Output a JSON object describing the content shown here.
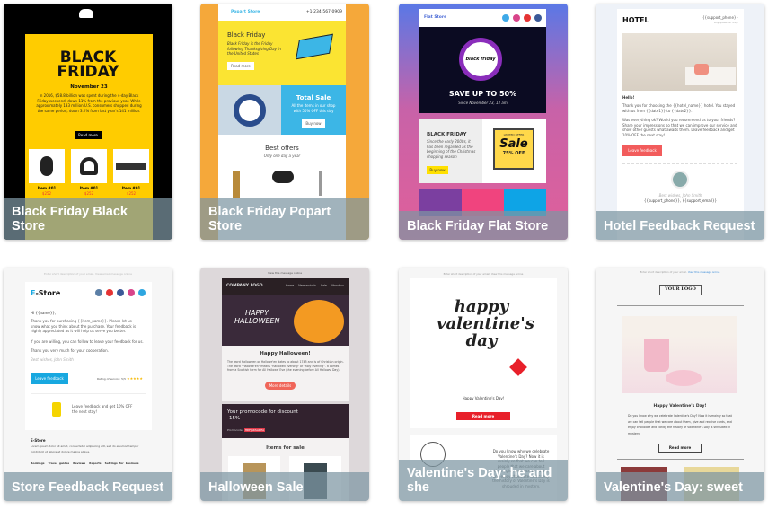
{
  "templates": [
    {
      "title": "Black Friday Black Store",
      "heading": "BLACK FRIDAY",
      "date": "November 23",
      "body": "In 2016, $58.8 billion was spent during the 4-day Black Friday weekend, down 11% from the previous year. While approximately 133 million U.S. consumers shopped during the same period, down 3.2% from last year's 141 million.",
      "button": "Read more",
      "items": [
        {
          "name": "Item #01",
          "price": "$252"
        },
        {
          "name": "Item #01",
          "price": "$252"
        },
        {
          "name": "Item #01",
          "price": "$252"
        }
      ]
    },
    {
      "title": "Black Friday Popart Store",
      "store": "Popart Store",
      "phone": "+1-234-567-0909",
      "heading": "Black Friday",
      "body": "Black Friday is the Friday following Thanksgiving Day in the United States",
      "button": "Read more",
      "sale_title": "Total Sale",
      "sale_text": "All the items in our shop with 50% OFF this day",
      "sale_button": "Buy now",
      "offers_title": "Best offers",
      "offers_sub": "Only one day a year"
    },
    {
      "title": "Black Friday Flat Store",
      "store": "Flat Store",
      "banner_text": "black friday",
      "headline": "SAVE UP TO 50%",
      "since": "Since November 23, 12 am",
      "panel_title": "BLACK FRIDAY",
      "panel_text": "Since the early 2000s, it has been regarded as the beginning of the Christmas shopping season",
      "panel_button": "Buy now",
      "badge_top": "LIMITED OFFER",
      "badge_main": "Sale",
      "badge_bottom": "75% OFF"
    },
    {
      "title": "Hotel Feedback Request",
      "logo": "HOTEL",
      "phone": "{{support_phone}}",
      "phone_note": "any question 24/7",
      "greeting": "Hello!",
      "p1": "Thank you for choosing the {{hotel_name}} hotel. You stayed with us from {{date1}} to {{date2}}.",
      "p2": "Was everything ok? Would you recommend us to your friends? Share your impressions so that we can improve our service and show other guests what awaits them. Leave feedback and get 10% OFF the next stay!",
      "button": "Leave feedback",
      "sign": "Best wishes, John Smith",
      "contacts": "{{support_phone}}, {{support_email}}"
    },
    {
      "title": "Store Feedback Request",
      "preheader": "Enter short description of your email. View email message online",
      "logo_e": "E",
      "logo_rest": "-Store",
      "greeting": "Hi {{name}},",
      "p1": "Thank you for purchasing {{item_name}}. Please let us know what you think about the purchase. Your feedback is highly appreciated as it will help us serve you better.",
      "p2": "If you are willing, you can follow to leave your feedback for us.",
      "p3": "Thank you very much for your cooperation.",
      "sign": "Best wishes, John Smith",
      "button": "Leave feedback",
      "rating": "Rating of service: 5/5",
      "stars": "★★★★★",
      "promo": "Leave feedback and get 10% OFF the next stay!",
      "footer_title": "E-Store",
      "footer_text": "Lorem ipsum dolor sit amet, consectetur adipiscing elit, sed do eiusmod tempor incididunt ut labore et dolore magna aliqua.",
      "footer_links": [
        "Bookings",
        "Travel guides",
        "Reviews",
        "Reports",
        "Settings for business"
      ]
    },
    {
      "title": "Halloween Sale",
      "preheader": "View this message online",
      "logo": "COMPANY LOGO",
      "nav": [
        "Home",
        "New arrivals",
        "Sale",
        "About us"
      ],
      "banner": "HAPPY HALLOWEEN",
      "heading": "Happy Halloween!",
      "body": "The word Halloween or Hallowe'en dates to about 1745 and is of Christian origin. The word \"Hallowe'en\" means \"hallowed evening\" or \"holy evening\". It comes from a Scottish term for All Hallows' Eve (the evening before All Hallows' Day).",
      "button": "More details",
      "promo": "Your promocode for discount -15%",
      "promo_label": "Promocode:",
      "promo_code": "HDFJAKSADEA",
      "items_title": "Items for sale"
    },
    {
      "title": "Valentine's Day: he and she",
      "preheader": "Enter short description of your email. View this message online",
      "lettering": "happy valentine's day",
      "greeting": "Happy Valentine's Day!",
      "button": "Read more",
      "body": "Do you know why we celebrate Valentine's Day? Now it is mainly so that we can tell people that we care about them, give and receive cards, and enjoy chocolate and candy the history of Valentine's Day is shrouded in mystery."
    },
    {
      "title": "Valentine's Day: sweet",
      "preheader": "Enter short description of your email.",
      "preheader_link": "View this message online",
      "logo": "YOUR LOGO",
      "heading": "Happy Valentine's Day!",
      "body": "Do you know why we celebrate Valentine's Day? Now it is mainly so that we can tell people that we care about them, give and receive cards, and enjoy chocolate and candy the history of Valentine's Day is shrouded in mystery.",
      "button": "Read more"
    }
  ],
  "colors": {
    "caption_overlay": "#7d96a2",
    "bf_yellow": "#ffcc00",
    "popart_orange": "#f5a83a",
    "popart_blue": "#3cb6e6",
    "flat_gradient_top": "#5a78e6",
    "flat_gradient_bottom": "#e0609a",
    "hotel_red": "#f25c5c",
    "estore_blue": "#18a8e0",
    "valentine_red": "#e8202a"
  }
}
